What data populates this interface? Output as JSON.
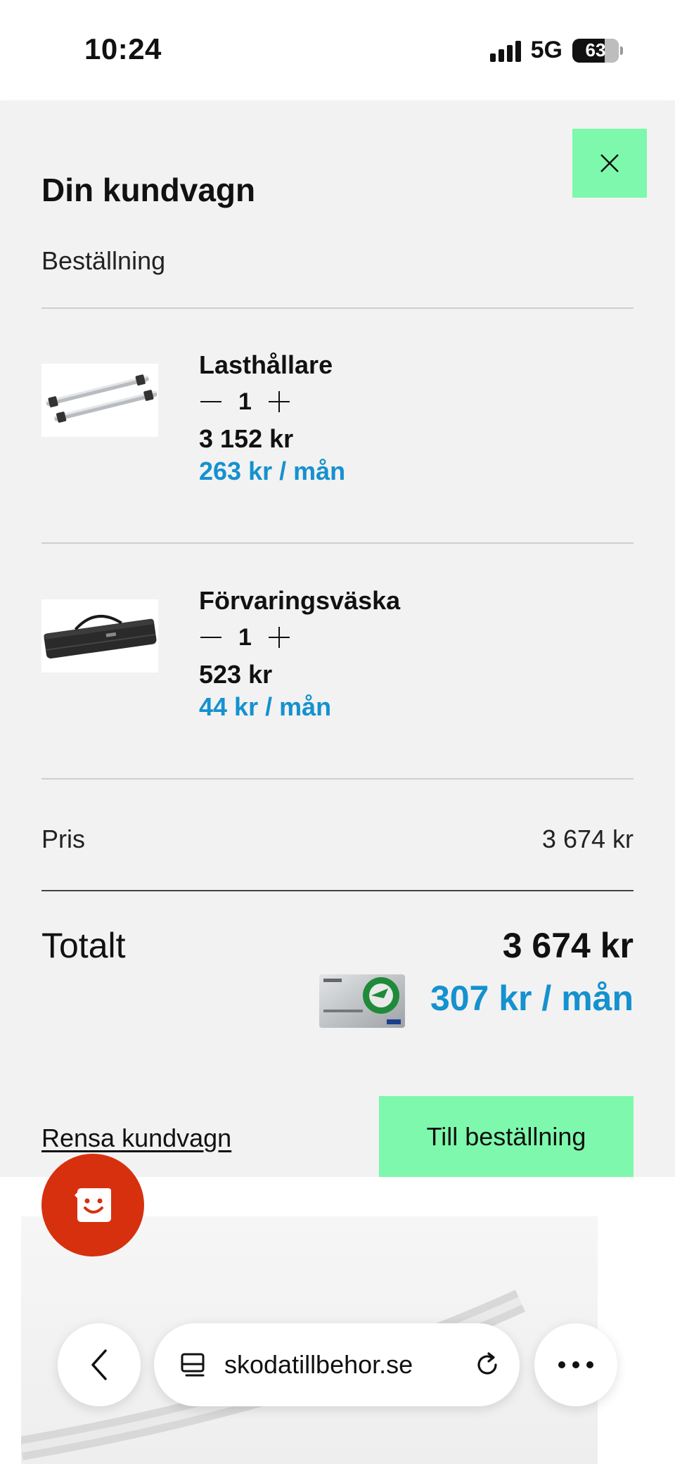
{
  "status_bar": {
    "time": "10:24",
    "network": "5G",
    "battery": "63"
  },
  "cart": {
    "title": "Din kundvagn",
    "subtitle": "Beställning",
    "close_icon": "close-icon",
    "items": [
      {
        "name": "Lasthållare",
        "quantity": "1",
        "price": "3 152 kr",
        "monthly": "263 kr / mån",
        "thumbnail": "roof-rack-image"
      },
      {
        "name": "Förvaringsväska",
        "quantity": "1",
        "price": "523 kr",
        "monthly": "44 kr / mån",
        "thumbnail": "storage-bag-image"
      }
    ],
    "price_label": "Pris",
    "price_value": "3 674 kr",
    "total_label": "Totalt",
    "total_value": "3 674 kr",
    "total_monthly": "307 kr / mån",
    "clear_label": "Rensa kundvagn",
    "checkout_label": "Till beställning"
  },
  "browser": {
    "url": "skodatillbehor.se"
  },
  "colors": {
    "accent_green": "#7ef8ac",
    "monthly_blue": "#1591cf",
    "chat_red": "#d7300e",
    "panel_bg": "#f2f2f2"
  }
}
